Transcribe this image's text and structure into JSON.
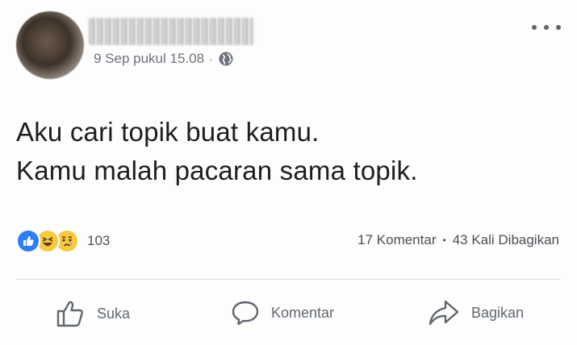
{
  "post": {
    "timestamp": "9 Sep pukul 15.08",
    "separator": "·",
    "privacy_icon": "globe-icon",
    "text_lines": [
      "Aku cari topik buat kamu.",
      "Kamu malah pacaran sama topik."
    ]
  },
  "reactions": {
    "icons": [
      "like-icon",
      "haha-icon",
      "sad-icon"
    ],
    "count": "103"
  },
  "stats": {
    "comments": "17 Komentar",
    "separator": "•",
    "shares": "43 Kali Dibagikan"
  },
  "actions": {
    "like_label": "Suka",
    "comment_label": "Komentar",
    "share_label": "Bagikan"
  },
  "colors": {
    "like_blue": "#2e7cf6",
    "emoji_yellow": "#f7c940",
    "secondary_text": "#606770"
  }
}
